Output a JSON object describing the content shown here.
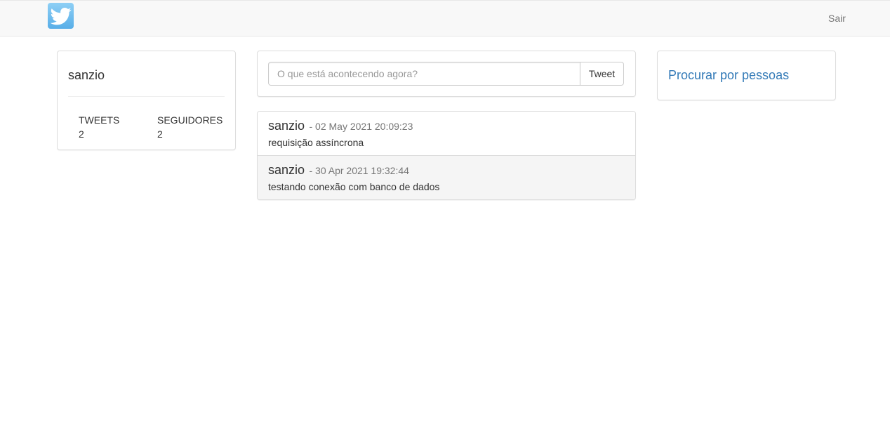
{
  "navbar": {
    "logo_icon": "twitter-bird-icon",
    "logout_label": "Sair"
  },
  "profile": {
    "username": "sanzio",
    "stats": {
      "tweets_label": "TWEETS",
      "tweets_count": "2",
      "followers_label": "SEGUIDORES",
      "followers_count": "2"
    }
  },
  "compose": {
    "placeholder": "O que está acontecendo agora?",
    "button_label": "Tweet"
  },
  "feed": {
    "tweets": [
      {
        "author": "sanzio",
        "date": "- 02 May 2021 20:09:23",
        "text": "requisição assíncrona"
      },
      {
        "author": "sanzio",
        "date": "- 30 Apr 2021 19:32:44",
        "text": "testando conexão com banco de dados"
      }
    ]
  },
  "sidebar": {
    "search_people_label": "Procurar por pessoas"
  },
  "colors": {
    "accent": "#337ab7",
    "navbar_bg": "#f8f8f8",
    "logo": "#55acee"
  }
}
